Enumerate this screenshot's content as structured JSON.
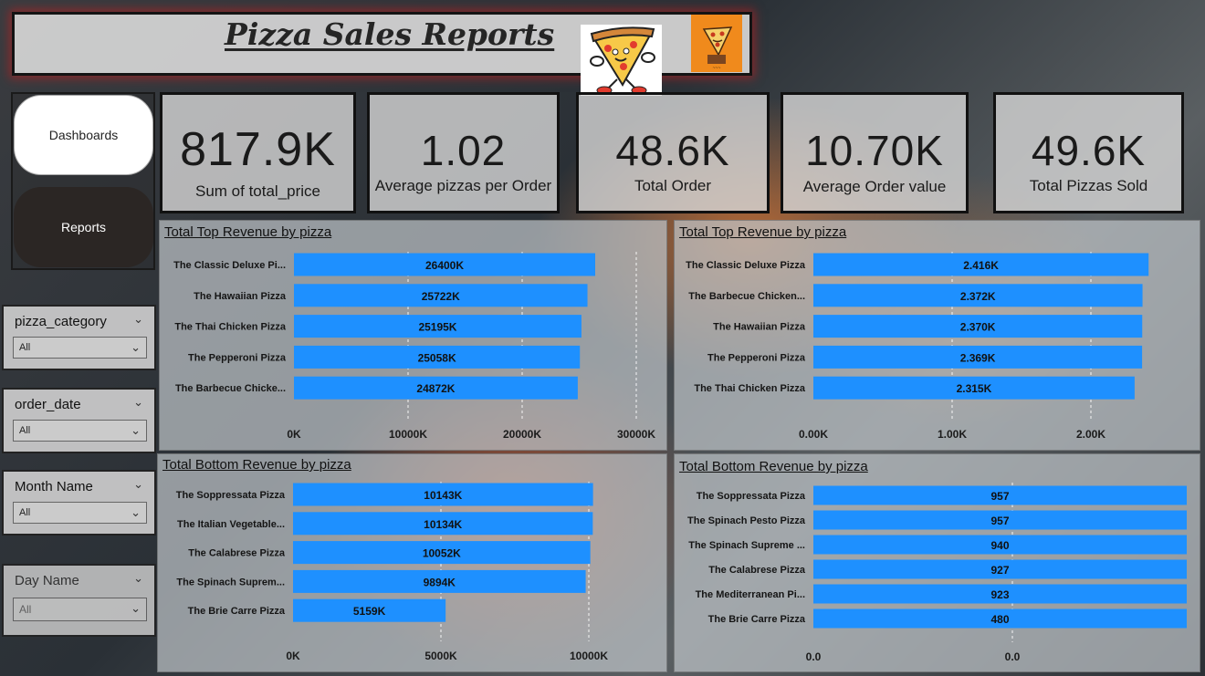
{
  "header": {
    "title": "Pizza Sales Reports"
  },
  "nav": {
    "dashboards_label": "Dashboards",
    "reports_label": "Reports"
  },
  "kpis": [
    {
      "value": "817.9K",
      "label": "Sum of total_price"
    },
    {
      "value": "1.02",
      "label": "Average pizzas per Order"
    },
    {
      "value": "48.6K",
      "label": "Total Order"
    },
    {
      "value": "10.70K",
      "label": "Average Order value"
    },
    {
      "value": "49.6K",
      "label": "Total Pizzas Sold"
    }
  ],
  "slicers": [
    {
      "title": "pizza_category",
      "value": "All"
    },
    {
      "title": "order_date",
      "value": "All"
    },
    {
      "title": "Month Name",
      "value": "All"
    },
    {
      "title": "Day Name",
      "value": "All"
    }
  ],
  "colors": {
    "bar": "#1e90ff"
  },
  "icons": {
    "chevron": "chevron-down-icon"
  },
  "chart_data": [
    {
      "type": "bar",
      "orientation": "horizontal",
      "title": "Total Top Revenue by pizza",
      "categories": [
        "The Classic Deluxe Pi...",
        "The Hawaiian Pizza",
        "The Thai Chicken Pizza",
        "The Pepperoni Pizza",
        "The Barbecue Chicke..."
      ],
      "values": [
        26400,
        25722,
        25195,
        25058,
        24872
      ],
      "labels": [
        "26400K",
        "25722K",
        "25195K",
        "25058K",
        "24872K"
      ],
      "xlim": [
        0,
        30000
      ],
      "ticks": [
        0,
        10000,
        20000,
        30000
      ],
      "tick_labels": [
        "0K",
        "10000K",
        "20000K",
        "30000K"
      ]
    },
    {
      "type": "bar",
      "orientation": "horizontal",
      "title": "Total Top Revenue by pizza",
      "categories": [
        "The Classic Deluxe Pizza",
        "The Barbecue Chicken...",
        "The Hawaiian Pizza",
        "The Pepperoni Pizza",
        "The Thai Chicken Pizza"
      ],
      "values": [
        2.416,
        2.372,
        2.37,
        2.369,
        2.315
      ],
      "labels": [
        "2.416K",
        "2.372K",
        "2.370K",
        "2.369K",
        "2.315K"
      ],
      "xlim": [
        0,
        2.5
      ],
      "ticks": [
        0,
        1,
        2
      ],
      "tick_labels": [
        "0.00K",
        "1.00K",
        "2.00K"
      ]
    },
    {
      "type": "bar",
      "orientation": "horizontal",
      "title": "Total Bottom Revenue by pizza",
      "categories": [
        "The Soppressata Pizza",
        "The Italian Vegetable...",
        "The Calabrese Pizza",
        "The Spinach Suprem...",
        "The Brie Carre Pizza"
      ],
      "values": [
        10143,
        10134,
        10052,
        9894,
        5159
      ],
      "labels": [
        "10143K",
        "10134K",
        "10052K",
        "9894K",
        "5159K"
      ],
      "xlim": [
        0,
        10000
      ],
      "ticks": [
        0,
        5000,
        10000
      ],
      "tick_labels": [
        "0K",
        "5000K",
        "10000K"
      ]
    },
    {
      "type": "bar",
      "orientation": "horizontal",
      "title": "Total Bottom Revenue by pizza",
      "categories": [
        "The Soppressata Pizza",
        "The Spinach Pesto Pizza",
        "The Spinach Supreme ...",
        "The Calabrese Pizza",
        "The Mediterranean Pi...",
        "The Brie Carre Pizza"
      ],
      "values": [
        957,
        957,
        940,
        927,
        923,
        480
      ],
      "labels": [
        "957",
        "957",
        "940",
        "927",
        "923",
        "480"
      ],
      "xlim": [
        0,
        957
      ],
      "ticks": [
        0,
        0
      ],
      "tick_labels": [
        "0.0",
        "0.0"
      ]
    }
  ]
}
